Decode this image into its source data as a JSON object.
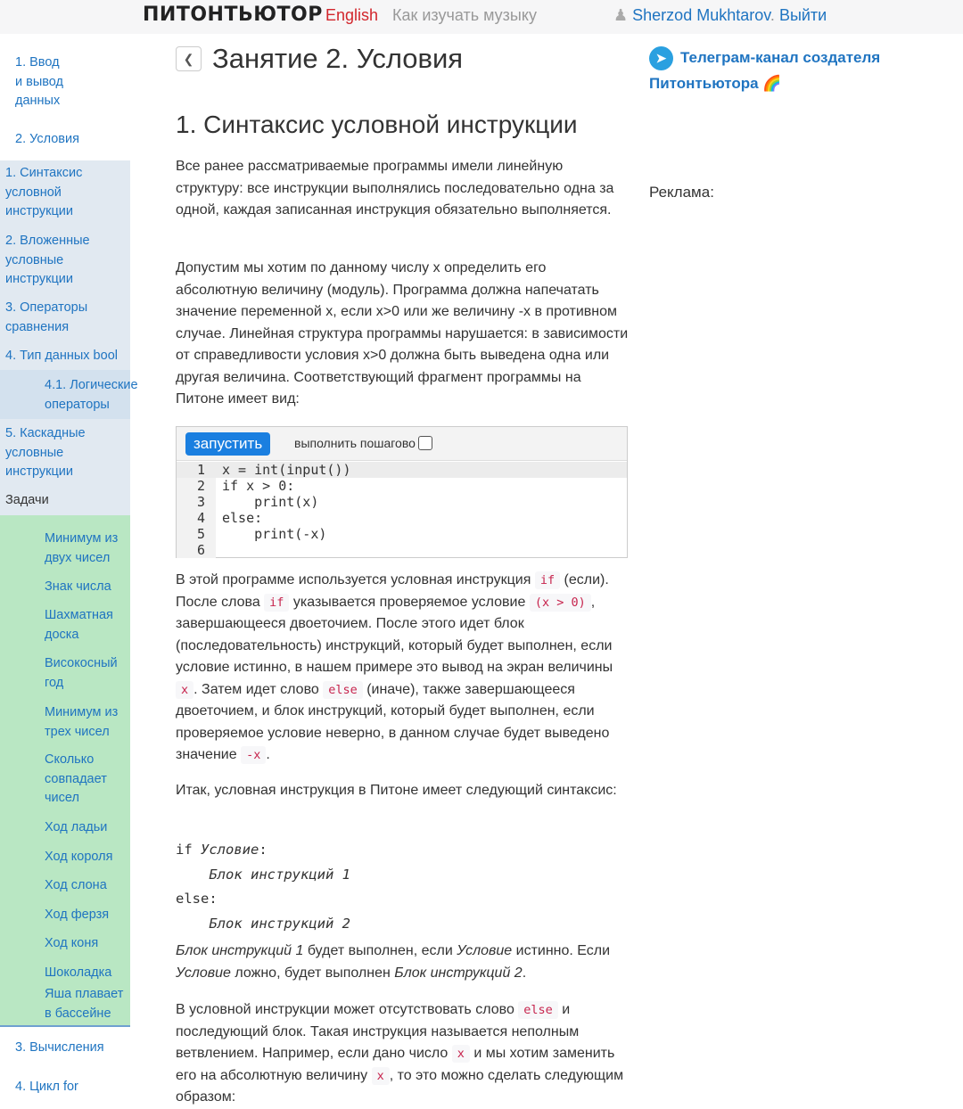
{
  "topbar": {
    "logo": "ПИТОНТЬЮТОР",
    "lang": "English",
    "music": "Как изучать музыку",
    "user": "Sherzod Mukhtarov",
    "sep": ".",
    "logout": "Выйти"
  },
  "sidebar": {
    "lessons_top": [
      {
        "label": "1. Ввод и вывод данных"
      },
      {
        "label": "2. Условия"
      }
    ],
    "sections": [
      {
        "label": "1. Синтаксис условной инструкции"
      },
      {
        "label": "2. Вложенные условные инструкции"
      },
      {
        "label": "3. Операторы сравнения"
      },
      {
        "label": "4. Тип данных bool"
      },
      {
        "label": "4.1. Логические операторы"
      },
      {
        "label": "5. Каскадные условные инструкции"
      }
    ],
    "tasks_label": "Задачи",
    "tasks": [
      "Минимум из двух чисел",
      "Знак числа",
      "Шахматная доска",
      "Високосный год",
      "Минимум из трех чисел",
      "Сколько совпадает чисел",
      "Ход ладьи",
      "Ход короля",
      "Ход слона",
      "Ход ферзя",
      "Ход коня",
      "Шоколадка",
      "Яша плавает в бассейне"
    ],
    "lessons_bottom": [
      {
        "label": "3. Вычисления"
      },
      {
        "label": "4. Цикл for"
      }
    ]
  },
  "main": {
    "title": "Занятие 2. Условия",
    "section_title": "1. Синтаксис условной инструкции",
    "paragraphs": [
      [
        {
          "t": "Все ранее рассматриваемые программы имели линейную структуру: все инструкции выполнялись последовательно одна за одной, каждая записанная инструкция обязательно выполняется."
        }
      ],
      [
        {
          "t": "Допустим мы хотим по данному числу x определить его абсолютную величину (модуль). Программа должна напечатать значение переменной x, если x>0 или же величину -x в противном случае. Линейная структура программы нарушается: в зависимости от справедливости условия x>0 должна быть выведена одна или другая величина. Соответствующий фрагмент программы на Питоне имеет вид:"
        }
      ],
      [
        {
          "t": "В этой программе используется условная инструкция "
        },
        {
          "c": "if"
        },
        {
          "t": " (если). После слова "
        },
        {
          "c": "if"
        },
        {
          "t": " указывается проверяемое условие "
        },
        {
          "c": "(x > 0)"
        },
        {
          "t": ", завершающееся двоеточием. После этого идет блок (последовательность) инструкций, который будет выполнен, если условие истинно, в нашем примере это вывод на экран величины "
        },
        {
          "c": "x"
        },
        {
          "t": ". Затем идет слово "
        },
        {
          "c": "else"
        },
        {
          "t": " (иначе), также завершающееся двоеточием, и блок инструкций, который будет выполнен, если проверяемое условие неверно, в данном случае будет выведено значение "
        },
        {
          "c": "-x"
        },
        {
          "t": "."
        }
      ],
      [
        {
          "t": "Итак, условная инструкция в Питоне имеет следующий синтаксис:"
        }
      ],
      [
        {
          "i": "Блок инструкций 1"
        },
        {
          "t": " будет выполнен, если "
        },
        {
          "i": "Условие"
        },
        {
          "t": " истинно. Если "
        },
        {
          "i": "Условие"
        },
        {
          "t": " ложно, будет выполнен "
        },
        {
          "i": "Блок инструкций 2"
        },
        {
          "t": "."
        }
      ],
      [
        {
          "t": "В условной инструкции может отсутствовать слово "
        },
        {
          "c": "else"
        },
        {
          "t": " и последующий блок. Такая инструкция называется неполным ветвлением. Например, если дано число "
        },
        {
          "c": "x"
        },
        {
          "t": " и мы хотим заменить его на абсолютную величину "
        },
        {
          "c": "x"
        },
        {
          "t": ", то это можно сделать следующим образом:"
        }
      ]
    ],
    "ide": {
      "run": "запустить",
      "step": "выполнить пошагово",
      "lines": [
        "x = int(input())",
        "if x > 0:",
        "    print(x)",
        "else:",
        "    print(-x)",
        ""
      ]
    },
    "syntax": {
      "if_kw": "if ",
      "cond": "Условие",
      "colon": ":",
      "block1": "Блок инструкций 1",
      "else_kw": "else:",
      "block2": "Блок инструкций 2"
    }
  },
  "right": {
    "telegram": "Телеграм-канал создателя Питонтьютора",
    "rainbow": "🌈",
    "ad": "Реклама:"
  }
}
